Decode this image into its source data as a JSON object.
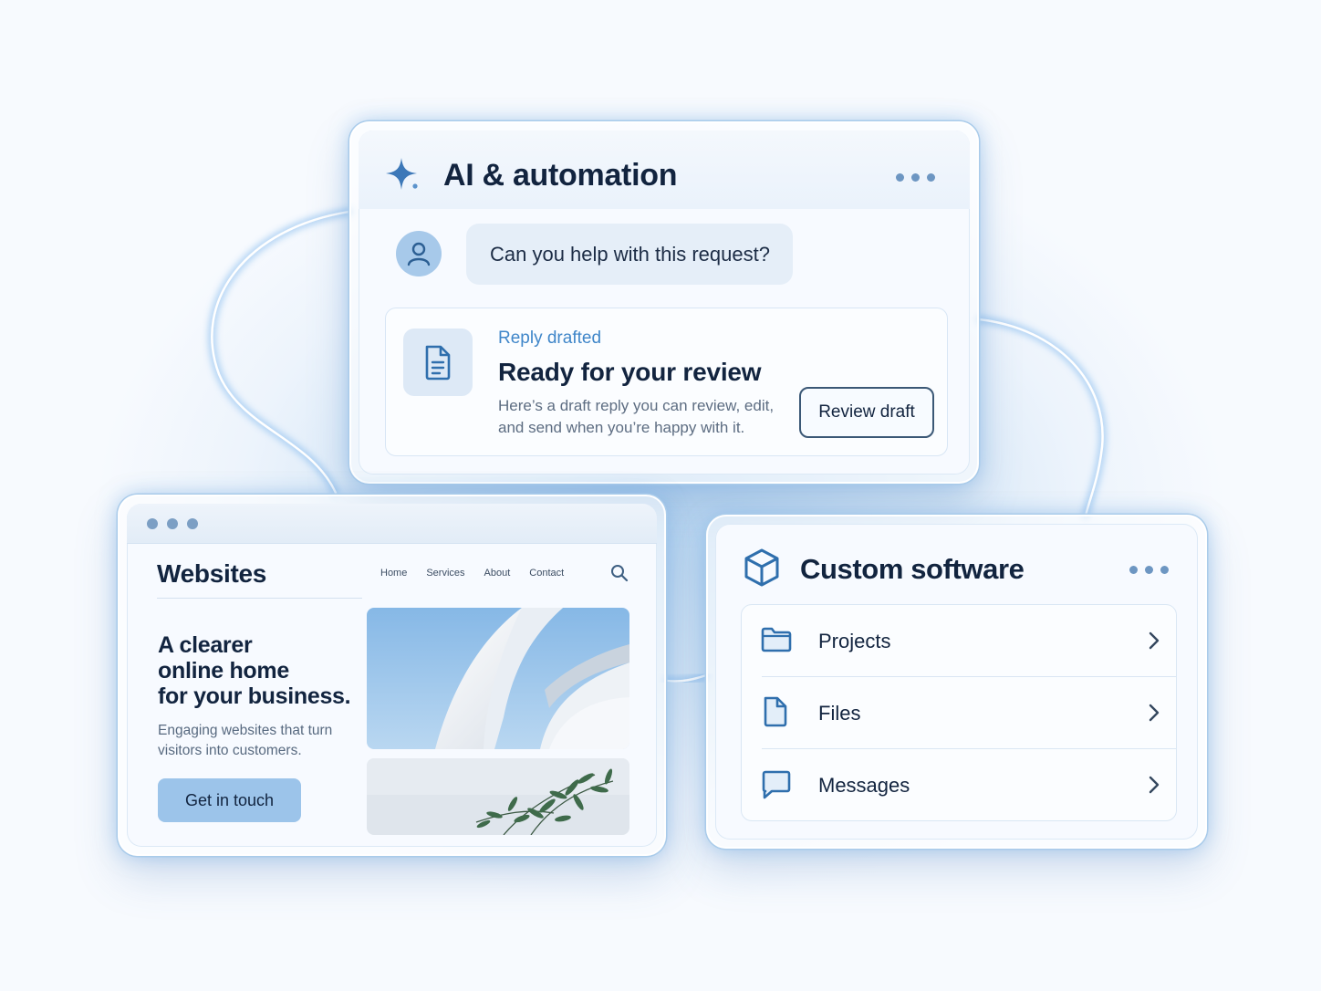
{
  "ai_panel": {
    "title": "AI & automation",
    "icon": "sparkle-icon",
    "user_message": "Can you help with this request?",
    "reply": {
      "status": "Reply drafted",
      "title": "Ready for your review",
      "description": "Here’s a draft reply you can review, edit, and send when you’re happy with it.",
      "button_label": "Review draft"
    }
  },
  "websites_panel": {
    "brand": "Websites",
    "nav": [
      "Home",
      "Services",
      "About",
      "Contact"
    ],
    "heading_lines": [
      "A clearer",
      "online home",
      "for your business."
    ],
    "subtext": "Engaging websites that turn visitors into customers.",
    "cta_label": "Get in touch"
  },
  "software_panel": {
    "title": "Custom software",
    "icon": "cube-icon",
    "items": [
      {
        "label": "Projects",
        "icon": "folder-icon"
      },
      {
        "label": "Files",
        "icon": "file-icon"
      },
      {
        "label": "Messages",
        "icon": "chat-icon"
      }
    ]
  },
  "colors": {
    "accent": "#3f86c9",
    "dark_text": "#12243f",
    "button_fill": "#9cc4ea",
    "icon_blue": "#2f6fad"
  }
}
